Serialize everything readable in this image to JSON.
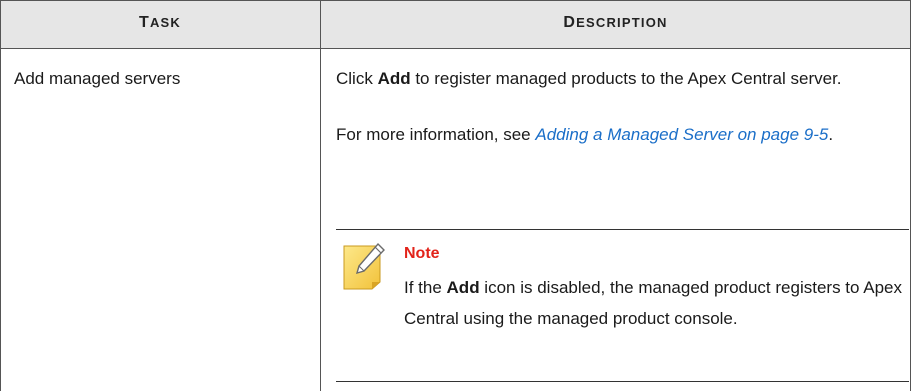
{
  "header": {
    "task": {
      "first": "T",
      "rest": "ASK"
    },
    "description": {
      "first": "D",
      "rest": "ESCRIPTION"
    }
  },
  "row": {
    "task": "Add managed servers",
    "para1": {
      "prefix": "Click ",
      "bold": "Add",
      "suffix": " to register managed products to the Apex Central server."
    },
    "para2": {
      "prefix": "For more information, see ",
      "link": "Adding a Managed Server on page 9-5",
      "suffix": "."
    },
    "note": {
      "title": "Note",
      "prefix": "If the ",
      "bold": "Add",
      "suffix": " icon is disabled, the managed product registers to Apex Central using the managed product console."
    }
  },
  "icons": {
    "note": "note-pencil-icon"
  },
  "colors": {
    "link": "#1a6ec8",
    "note_title": "#e2231a",
    "header_bg": "#e6e6e6"
  }
}
